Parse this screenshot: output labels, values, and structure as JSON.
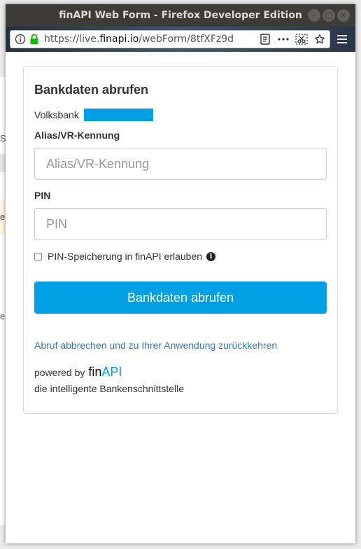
{
  "window": {
    "title": "finAPI Web Form - Firefox Developer Edition",
    "controls": [
      "–",
      "□",
      "×"
    ]
  },
  "urlbar": {
    "url_prefix": "https://live.",
    "url_host": "finapi.io",
    "url_rest": "/webForm/8tfXFz9d",
    "icons": [
      "info-icon",
      "lock-icon",
      "reader-view-icon",
      "page-actions-icon",
      "screenshot-icon",
      "bookmark-star-icon",
      "hamburger-menu-icon"
    ]
  },
  "background_page": {
    "marks": [
      "S",
      "e",
      "e"
    ]
  },
  "form": {
    "heading": "Bankdaten abrufen",
    "bank_name": "Volksbank",
    "redaction_color": "#00a1e4",
    "alias_label": "Alias/VR-Kennung",
    "alias_placeholder": "Alias/VR-Kennung",
    "pin_label": "PIN",
    "pin_placeholder": "PIN",
    "store_pin_label": "PIN-Speicherung in finAPI erlauben",
    "store_pin_checked": false,
    "submit_label": "Bankdaten abrufen",
    "cancel_link": "Abruf abbrechen und zu Ihrer Anwendung zurückkehren",
    "powered_by": "powered by",
    "logo_fin": "fin",
    "logo_api": "API",
    "tagline": "die intelligente Bankenschnittstelle"
  },
  "colors": {
    "accent": "#00a1e4",
    "link": "#337ab7",
    "titlebar": "#3c3b37"
  }
}
